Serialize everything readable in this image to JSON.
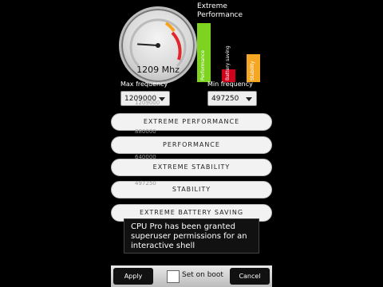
{
  "gauge": {
    "readout": "1209 Mhz",
    "needle_fraction": 0.18
  },
  "perf": {
    "title_line1": "Extreme",
    "title_line2": "Performance",
    "bars": [
      {
        "label": "Performance",
        "color": "#7ed321",
        "level": 0.95
      },
      {
        "label": "Battery saving",
        "color": "#d0021b",
        "level": 0.2
      },
      {
        "label": "Stability",
        "color": "#f5a623",
        "level": 0.45
      }
    ]
  },
  "freq": {
    "max_label": "Max frequency",
    "min_label": "Min frequency",
    "max_value": "1209000",
    "min_value": "497250"
  },
  "ghost_list": [
    "1209000",
    "880000",
    "640000",
    "497250"
  ],
  "profiles": [
    "EXTREME PERFORMANCE",
    "PERFORMANCE",
    "EXTREME STABILITY",
    "STABILITY",
    "EXTREME BATTERY SAVING"
  ],
  "toast": "CPU Pro has been granted superuser permissions for an interactive shell",
  "bottom": {
    "apply": "Apply",
    "set_on_boot": "Set on boot",
    "cancel": "Cancel"
  }
}
